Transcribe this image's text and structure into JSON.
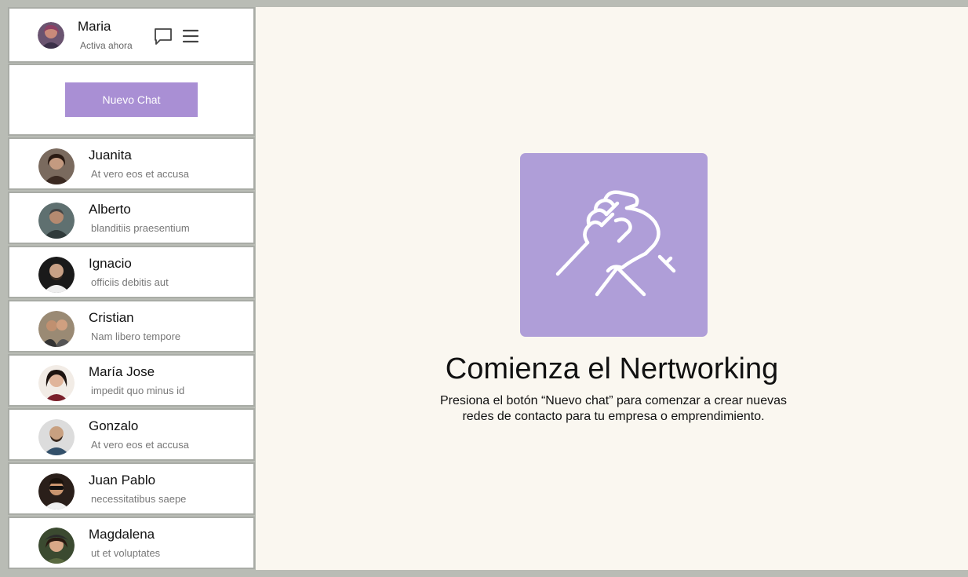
{
  "user": {
    "name": "Maria",
    "status": "Activa ahora"
  },
  "sidebar": {
    "new_chat_label": "Nuevo Chat",
    "contacts": [
      {
        "name": "Juanita",
        "preview": "At vero eos et accusa",
        "color": "#6b4a3a"
      },
      {
        "name": "Alberto",
        "preview": "blanditiis praesentium",
        "color": "#4d5b5a"
      },
      {
        "name": "Ignacio",
        "preview": "officiis debitis aut",
        "color": "#222222"
      },
      {
        "name": "Cristian",
        "preview": "Nam libero tempore",
        "color": "#8a6a55"
      },
      {
        "name": "María Jose",
        "preview": "impedit quo minus id",
        "color": "#3a2a24"
      },
      {
        "name": "Gonzalo",
        "preview": "At vero eos et accusa",
        "color": "#3d5870"
      },
      {
        "name": "Juan Pablo",
        "preview": "necessitatibus saepe",
        "color": "#5a4030"
      },
      {
        "name": "Magdalena",
        "preview": "ut et voluptates",
        "color": "#2e3a2a"
      }
    ]
  },
  "main": {
    "title": "Comienza el Nertworking",
    "description_line1": "Presiona el botón “Nuevo chat” para comenzar a crear nuevas",
    "description_line2": "redes de contacto para tu empresa o emprendimiento."
  },
  "icons": {
    "chat": "chat-bubble-icon",
    "menu": "hamburger-menu-icon",
    "hero": "handshake-icon"
  },
  "colors": {
    "accent": "#a98fd4",
    "hero_box": "#af9ed8",
    "background": "#faf7f0",
    "frame": "#b9bcb5"
  }
}
